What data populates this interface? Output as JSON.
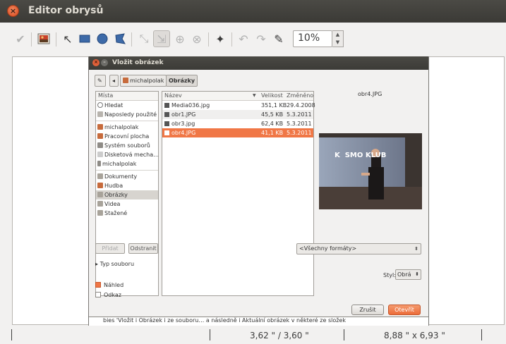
{
  "window": {
    "title": "Editor obrysů"
  },
  "toolbar": {
    "tools": [
      {
        "name": "apply-icon",
        "glyph": "✔"
      },
      {
        "name": "image-icon",
        "glyph": "▣"
      },
      {
        "name": "pointer-icon",
        "glyph": "↖"
      },
      {
        "name": "rectangle-icon",
        "glyph": "■"
      },
      {
        "name": "circle-icon",
        "glyph": "●"
      },
      {
        "name": "polygon-icon",
        "glyph": "⬠"
      },
      {
        "name": "move-icon",
        "glyph": "⤡"
      },
      {
        "name": "scale-icon",
        "glyph": "⇲"
      },
      {
        "name": "add-point-icon",
        "glyph": "⊕"
      },
      {
        "name": "remove-point-icon",
        "glyph": "⊗"
      },
      {
        "name": "magic-icon",
        "glyph": "✦"
      },
      {
        "name": "undo-icon",
        "glyph": "↶"
      },
      {
        "name": "redo-icon",
        "glyph": "↷"
      },
      {
        "name": "eyedropper-icon",
        "glyph": "✎"
      }
    ],
    "zoom_value": "10%"
  },
  "dialog": {
    "title": "Vložit obrázek",
    "crumbs": [
      "michalpolak",
      "Obrázky"
    ],
    "places_header": "Místa",
    "places": [
      "Hledat",
      "Naposledy použité",
      "michalpolak",
      "Pracovní plocha",
      "Systém souborů",
      "Disketová mecha…",
      "michalpolak",
      "Dokumenty",
      "Hudba",
      "Obrázky",
      "Videa",
      "Stažené"
    ],
    "columns": {
      "name": "Název",
      "size": "Velikost",
      "modified": "Změněno"
    },
    "files": [
      {
        "name": "Media036.jpg",
        "size": "351,1 KB",
        "modified": "29.4.2008"
      },
      {
        "name": "obr1.JPG",
        "size": "45,5 KB",
        "modified": "5.3.2011"
      },
      {
        "name": "obr3.jpg",
        "size": "62,4 KB",
        "modified": "5.3.2011"
      },
      {
        "name": "obr4.JPG",
        "size": "41,1 KB",
        "modified": "5.3.2011"
      }
    ],
    "preview_label": "obr4.JPG",
    "preview_banner": "K  SMO KLUB",
    "add_label": "Přidat",
    "remove_label": "Odstranit",
    "filter_value": "<Všechny formáty>",
    "file_type_label": "Typ souboru",
    "style_label": "Styl:",
    "style_value": "Obrá",
    "preview_check_label": "Náhled",
    "link_check_label": "Odkaz",
    "cancel_label": "Zrušit",
    "open_label": "Otevřít",
    "bottom_text": "bies 'Vložit i Obrázek i ze souboru… a následně i Aktuální obrázek v některé ze složek"
  },
  "status": {
    "position": "3,62 \" / 3,60 \"",
    "size": "8,88 \" x 6,93 \""
  },
  "colors": {
    "accent": "#f07746",
    "titlebar": "#3c3b37"
  }
}
